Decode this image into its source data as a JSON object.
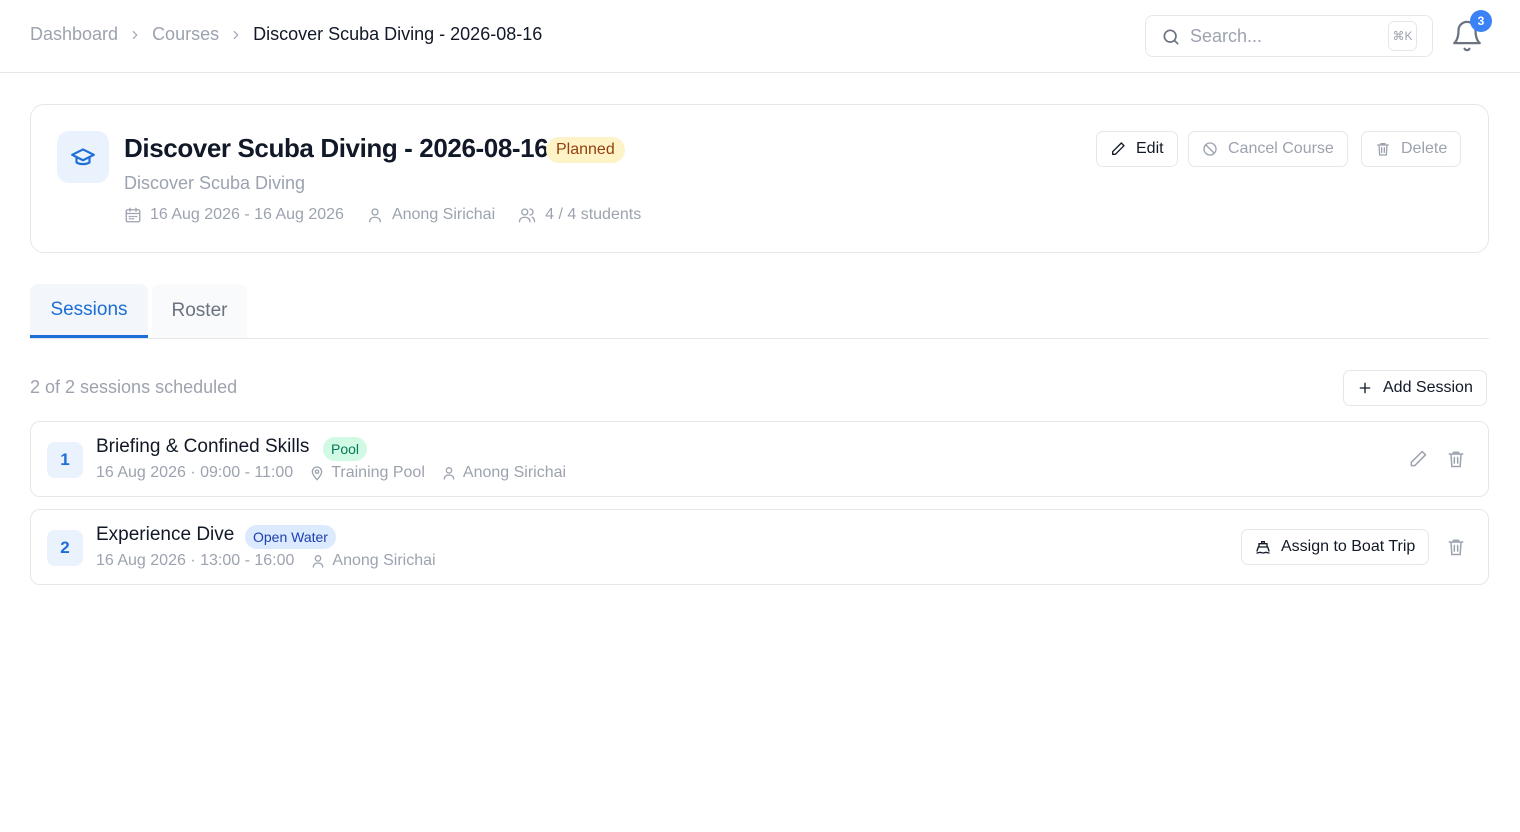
{
  "breadcrumb": {
    "items": [
      "Dashboard",
      "Courses"
    ],
    "current": "Discover Scuba Diving - 2026-08-16"
  },
  "search": {
    "placeholder": "Search...",
    "shortcut": "⌘K"
  },
  "notifications": {
    "count": "3"
  },
  "course": {
    "title": "Discover Scuba Diving - 2026-08-16",
    "status": "Planned",
    "subtitle": "Discover Scuba Diving",
    "dates": "16 Aug 2026 - 16 Aug 2026",
    "instructor": "Anong Sirichai",
    "students": "4 / 4 students",
    "actions": {
      "edit": "Edit",
      "cancel": "Cancel Course",
      "delete": "Delete"
    }
  },
  "tabs": [
    {
      "label": "Sessions",
      "active": true
    },
    {
      "label": "Roster",
      "active": false
    }
  ],
  "sessions_panel": {
    "count_text": "2 of 2 sessions scheduled",
    "add_label": "Add Session"
  },
  "sessions": [
    {
      "number": "1",
      "title": "Briefing & Confined Skills",
      "badge": "Pool",
      "datetime": "16 Aug 2026 · 09:00 - 11:00",
      "location": "Training Pool",
      "instructor": "Anong Sirichai"
    },
    {
      "number": "2",
      "title": "Experience Dive",
      "badge": "Open Water",
      "datetime": "16 Aug 2026 · 13:00 - 16:00",
      "instructor": "Anong Sirichai",
      "assign_label": "Assign to Boat Trip"
    }
  ],
  "colors": {
    "accent": "#1d6fd6",
    "planned_bg": "#fef3c7",
    "planned_text": "#92400e",
    "pool_bg": "#d1fae5",
    "open_water_bg": "#dbeafe"
  }
}
